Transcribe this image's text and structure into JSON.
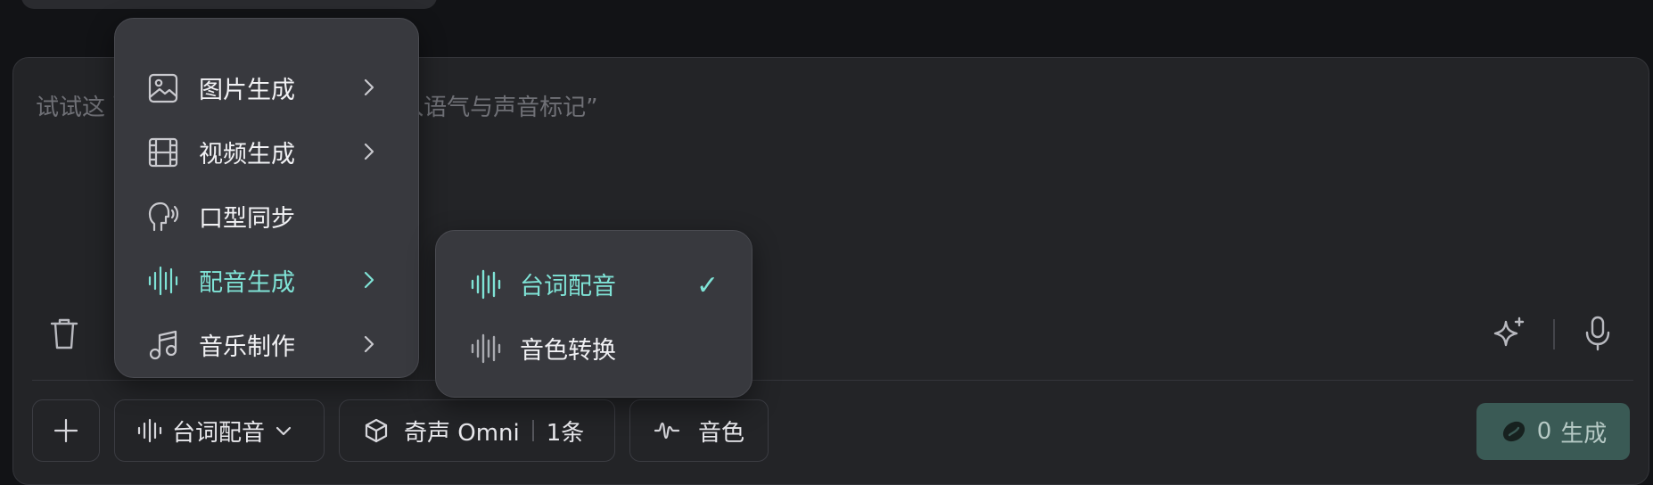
{
  "prompt": {
    "placeholder": "试试这      配音的台词，支持使用 [] 插入语气与声音标记”"
  },
  "toolbar": {
    "add_icon": "plus-icon",
    "mode_label": "台词配音",
    "model_name": "奇声 Omni",
    "count_label": "1条",
    "voice_label": "音色",
    "generate_count": "0",
    "generate_label": "生成"
  },
  "menu": {
    "items": [
      {
        "label": "图片生成",
        "icon": "image-icon",
        "has_submenu": true
      },
      {
        "label": "视频生成",
        "icon": "film-icon",
        "has_submenu": true
      },
      {
        "label": "口型同步",
        "icon": "head-sound-icon",
        "has_submenu": false
      },
      {
        "label": "配音生成",
        "icon": "waveform-icon",
        "has_submenu": true,
        "active": true
      },
      {
        "label": "音乐制作",
        "icon": "music-note-icon",
        "has_submenu": true
      }
    ]
  },
  "submenu": {
    "items": [
      {
        "label": "台词配音",
        "icon": "waveform-icon",
        "selected": true,
        "check": "✓"
      },
      {
        "label": "音色转换",
        "icon": "waveform-icon",
        "selected": false
      }
    ]
  },
  "colors": {
    "accent": "#7fe3d6",
    "background": "#121316",
    "panel": "#232427",
    "menu": "#38393e",
    "generate_button": "#3a5a55"
  }
}
